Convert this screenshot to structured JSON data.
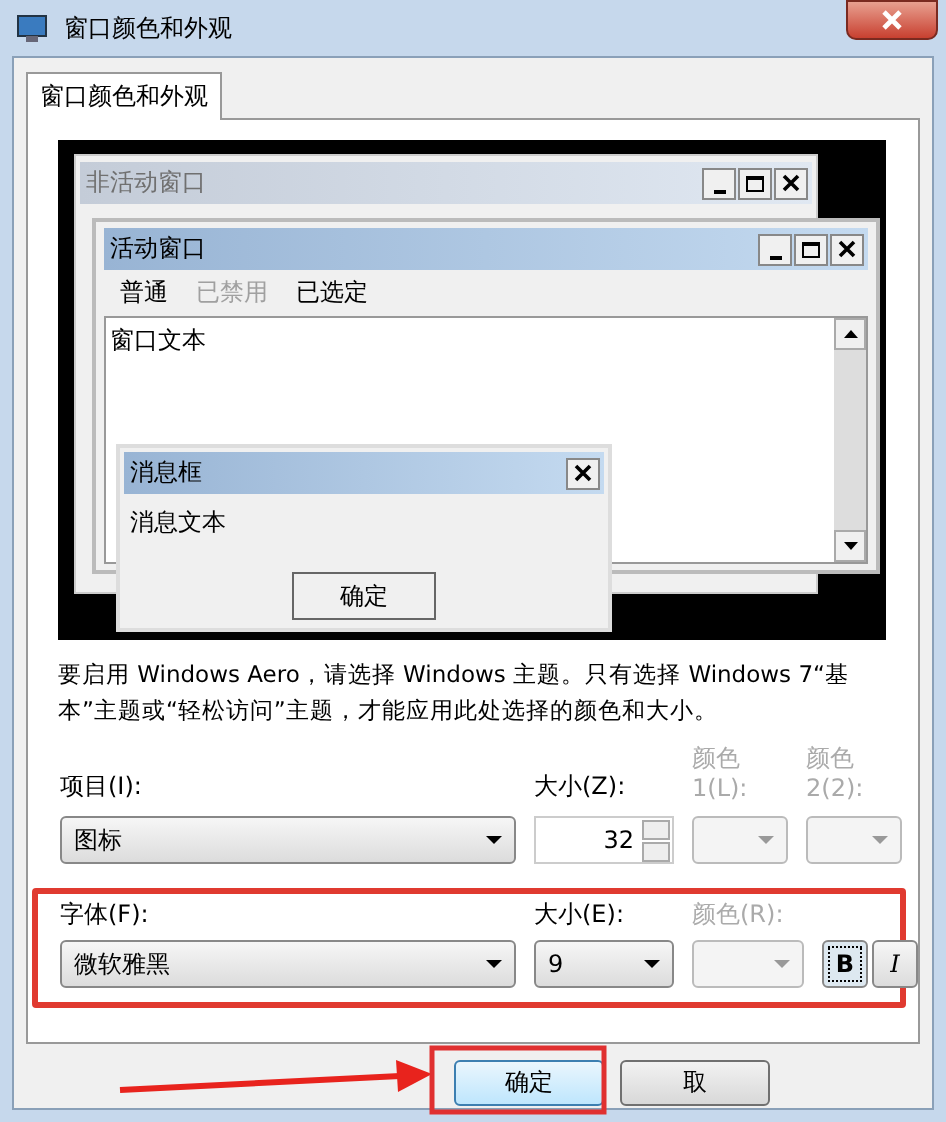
{
  "window": {
    "title": "窗口颜色和外观"
  },
  "tabs": [
    {
      "label": "窗口颜色和外观",
      "selected": true
    }
  ],
  "preview": {
    "inactive_window": {
      "title": "非活动窗口"
    },
    "active_window": {
      "title": "活动窗口",
      "menu": [
        {
          "label": "普通",
          "disabled": false
        },
        {
          "label": "已禁用",
          "disabled": true
        },
        {
          "label": "已选定",
          "disabled": false
        }
      ],
      "text": "窗口文本"
    },
    "message_box": {
      "title": "消息框",
      "text": "消息文本",
      "button": "确定"
    }
  },
  "notice": "要启用 Windows Aero，请选择 Windows 主题。只有选择 Windows 7“基本”主题或“轻松访问”主题，才能应用此处选择的颜色和大小。",
  "item": {
    "label": "项目(I):",
    "value": "图标"
  },
  "item_size": {
    "label": "大小(Z):",
    "value": "32"
  },
  "item_colors": [
    {
      "label": "颜色 1(L):",
      "disabled": true
    },
    {
      "label": "颜色 2(2):",
      "disabled": true
    }
  ],
  "font": {
    "label": "字体(F):",
    "value": "微软雅黑"
  },
  "font_size": {
    "label": "大小(E):",
    "value": "9"
  },
  "font_color": {
    "label": "颜色(R):",
    "disabled": true
  },
  "style_buttons": [
    {
      "label": "B",
      "selected": true
    },
    {
      "label": "I",
      "selected": false
    }
  ],
  "buttons": [
    {
      "label": "确定",
      "default": true
    },
    {
      "label": "取",
      "default": false
    }
  ]
}
